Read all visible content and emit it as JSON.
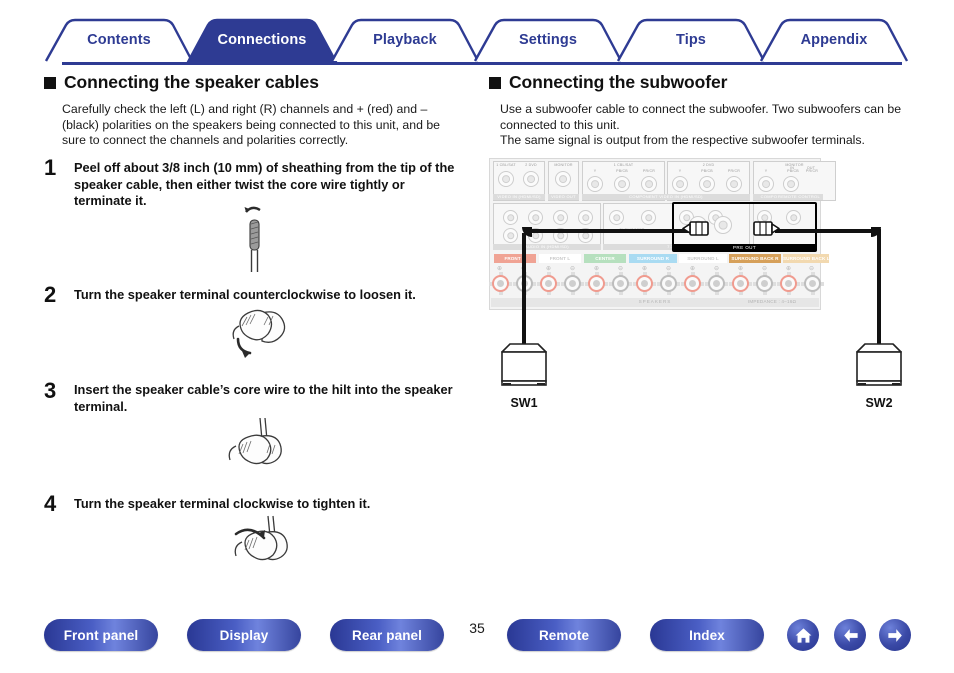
{
  "tabs": [
    {
      "label": "Contents",
      "active": false
    },
    {
      "label": "Connections",
      "active": true
    },
    {
      "label": "Playback",
      "active": false
    },
    {
      "label": "Settings",
      "active": false
    },
    {
      "label": "Tips",
      "active": false
    },
    {
      "label": "Appendix",
      "active": false
    }
  ],
  "left": {
    "heading": "Connecting the speaker cables",
    "intro": "Carefully check the left (L) and right (R) channels and + (red) and – (black) polarities on the speakers being connected to this unit, and be sure to connect the channels and polarities correctly.",
    "steps": [
      {
        "num": "1",
        "text": "Peel off about 3/8 inch (10 mm) of sheathing from the tip of the speaker cable, then either twist the core wire tightly or terminate it.",
        "figure": "twisted-wire-illustration"
      },
      {
        "num": "2",
        "text": "Turn the speaker terminal counterclockwise to loosen it.",
        "figure": "terminal-loosen-illustration"
      },
      {
        "num": "3",
        "text": "Insert the speaker cable’s core wire to the hilt into the speaker terminal.",
        "figure": "wire-insert-illustration"
      },
      {
        "num": "4",
        "text": "Turn the speaker terminal clockwise to tighten it.",
        "figure": "terminal-tighten-illustration"
      }
    ]
  },
  "right": {
    "heading": "Connecting the subwoofer",
    "intro1": "Use a subwoofer cable to connect the subwoofer. Two subwoofers can be connected to this unit.",
    "intro2": "The same signal is output from the respective subwoofer terminals.",
    "diagram": {
      "name": "rear-panel-subwoofer-connection-diagram",
      "video_in_groups": [
        {
          "caption": "1 CBL/SAT"
        },
        {
          "caption": "2 DVD"
        },
        {
          "caption": "MONITOR"
        }
      ],
      "component_video_in": {
        "bar": "COMPONENT VIDEO IN (HDMI/SD)",
        "groups": [
          {
            "caption": "1 CBL/SAT",
            "jacks": [
              "Y",
              "PB/CB",
              "PR/CR"
            ]
          },
          {
            "caption": "2 DVD",
            "jacks": [
              "Y",
              "PB/CB",
              "PR/CR"
            ]
          }
        ]
      },
      "component_video_out": {
        "bar": "COMPONENT VIDEO OUT",
        "caption": "MONITOR",
        "jacks": [
          "Y",
          "PB/CB",
          "PR/CR"
        ]
      },
      "remote_control": {
        "bar": "REMOTE CONTROL",
        "jacks": [
          "IN",
          "OUT"
        ]
      },
      "video_in_bar": "VIDEO IN (HDMI/SD)",
      "video_out_bar": "VIDEO OUT",
      "audio_in_bar": "AUDIO IN (HDMI/SD)",
      "ch_in_bar": "7.1CH IN",
      "pre_out_bar": "PRE OUT",
      "subwoofer_caption": "SUBWOOFER",
      "speakers_strip": "SPEAKERS",
      "impedance_note": "IMPEDANCE : 4–16Ω",
      "speaker_terminals": [
        {
          "label": "FRONT R",
          "color": "#f0a394"
        },
        {
          "label": "FRONT L",
          "color": "#ffffff"
        },
        {
          "label": "CENTER",
          "color": "#b6e0be"
        },
        {
          "label": "SURROUND R",
          "color": "#a9dbf2"
        },
        {
          "label": "SURROUND L",
          "color": "#ffffff"
        },
        {
          "label": "SURROUND BACK R",
          "color": "#d6a05a"
        },
        {
          "label": "SURROUND BACK L",
          "color": "#f2d9b0"
        }
      ],
      "polarity_plus": "⊕",
      "polarity_minus": "⊖",
      "subwoofers": [
        {
          "label": "SW1"
        },
        {
          "label": "SW2"
        }
      ]
    }
  },
  "footer": {
    "buttons": [
      {
        "label": "Front panel"
      },
      {
        "label": "Display"
      },
      {
        "label": "Rear panel"
      },
      {
        "label": "Remote"
      },
      {
        "label": "Index"
      }
    ],
    "page_number": "35",
    "icons": [
      {
        "name": "home-icon"
      },
      {
        "name": "arrow-left-icon"
      },
      {
        "name": "arrow-right-icon"
      }
    ]
  },
  "colors": {
    "brand_blue": "#2e3b93",
    "accent_red": "#f09b8f"
  }
}
